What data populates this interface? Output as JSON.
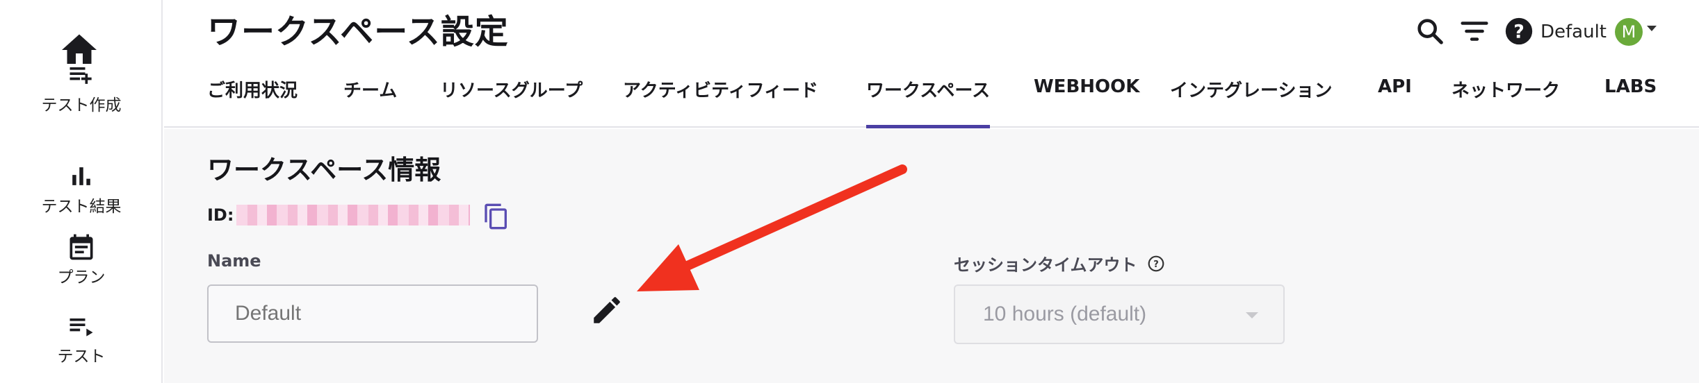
{
  "sidebar": {
    "home_icon": "home-icon",
    "items": [
      {
        "label": "テスト作成",
        "icon": "playlist-add-icon"
      },
      {
        "label": "テスト結果",
        "icon": "bar-chart-icon"
      },
      {
        "label": "プラン",
        "icon": "calendar-icon"
      },
      {
        "label": "テスト",
        "icon": "playlist-play-icon"
      }
    ]
  },
  "header": {
    "title": "ワークスペース設定",
    "workspace_name": "Default",
    "avatar_initial": "M",
    "tabs": [
      {
        "label": "ご利用状況"
      },
      {
        "label": "チーム"
      },
      {
        "label": "リソースグループ"
      },
      {
        "label": "アクティビティフィード"
      },
      {
        "label": "ワークスペース",
        "active": true
      },
      {
        "label": "WEBHOOK"
      },
      {
        "label": "インテグレーション"
      },
      {
        "label": "API"
      },
      {
        "label": "ネットワーク"
      },
      {
        "label": "LABS"
      }
    ]
  },
  "main": {
    "section_title": "ワークスペース情報",
    "id_label": "ID:",
    "name_label": "Name",
    "name_placeholder": "Default",
    "timeout_label": "セッションタイムアウト",
    "timeout_value": "10 hours (default)"
  },
  "colors": {
    "accent": "#4b3fa3",
    "avatar": "#6aaa3a",
    "annotation_arrow": "#f0311f"
  }
}
